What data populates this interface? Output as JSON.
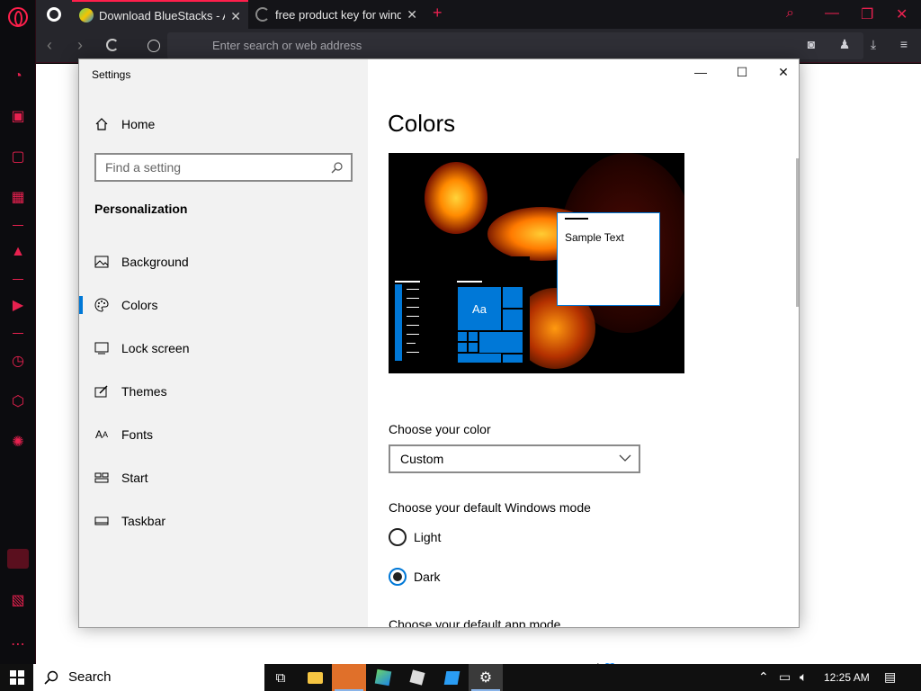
{
  "browser": {
    "tabs": [
      {
        "title": "Download BlueStacks - App",
        "active": true
      },
      {
        "title": "free product key for windo",
        "active": false
      }
    ],
    "address_placeholder": "Enter search or web address",
    "accent": "#ff1f4b"
  },
  "settings": {
    "window_title": "Settings",
    "home_label": "Home",
    "search_placeholder": "Find a setting",
    "section": "Personalization",
    "nav_items": [
      {
        "label": "Background",
        "icon": "image-icon"
      },
      {
        "label": "Colors",
        "icon": "palette-icon",
        "selected": true
      },
      {
        "label": "Lock screen",
        "icon": "lock-screen-icon"
      },
      {
        "label": "Themes",
        "icon": "themes-icon"
      },
      {
        "label": "Fonts",
        "icon": "fonts-icon"
      },
      {
        "label": "Start",
        "icon": "start-icon"
      },
      {
        "label": "Taskbar",
        "icon": "taskbar-icon"
      }
    ],
    "page_title": "Colors",
    "preview_tile_label": "Aa",
    "preview_sample_text": "Sample Text",
    "choose_color_label": "Choose your color",
    "choose_color_value": "Custom",
    "windows_mode_label": "Choose your default Windows mode",
    "mode_options": [
      {
        "label": "Light",
        "checked": false
      },
      {
        "label": "Dark",
        "checked": true
      }
    ],
    "app_mode_label": "Choose your default app mode",
    "accent_color": "#0078d7"
  },
  "taskbar": {
    "search_label": "Search",
    "time": "12:25 AM"
  }
}
